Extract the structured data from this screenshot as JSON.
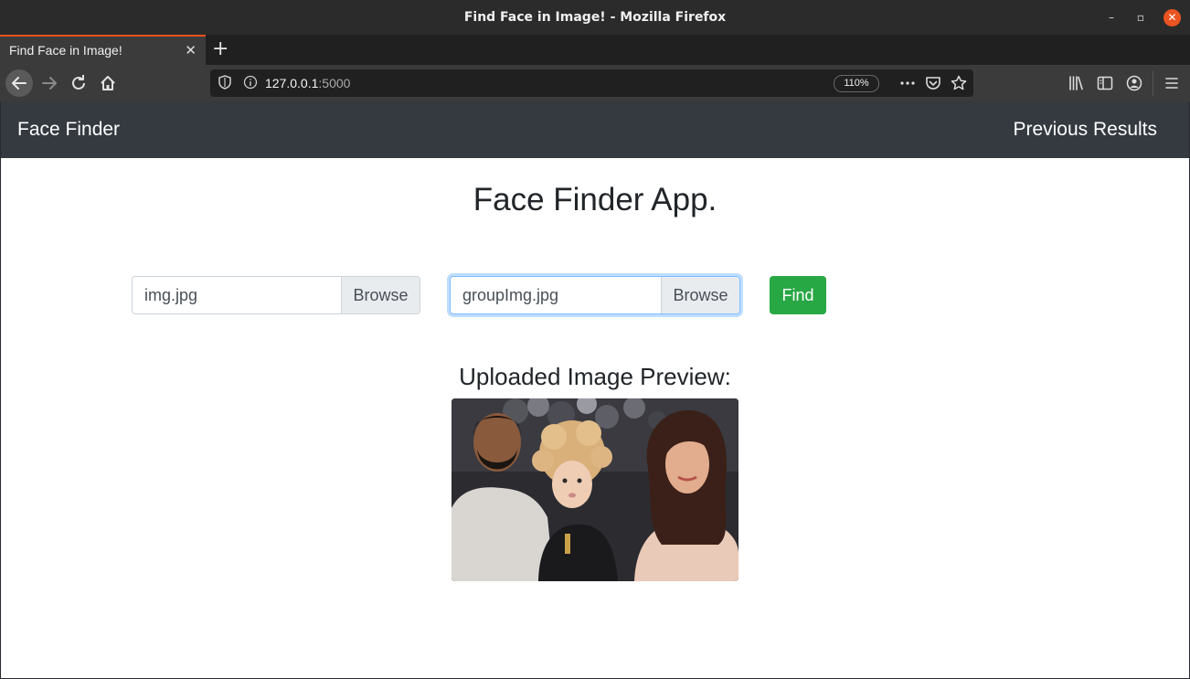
{
  "window": {
    "title": "Find Face in Image! - Mozilla Firefox",
    "minimize_glyph": "–",
    "maximize_glyph": "▫",
    "close_glyph": "✕"
  },
  "tabs": [
    {
      "label": "Find Face in Image!",
      "close_glyph": "✕"
    }
  ],
  "toolbar": {
    "new_tab_glyph": "+",
    "back_icon": "arrow-left-icon",
    "forward_icon": "arrow-right-icon",
    "reload_icon": "reload-icon",
    "home_icon": "home-icon",
    "url_host": "127.0.0.1",
    "url_port": ":5000",
    "zoom": "110%"
  },
  "app": {
    "brand": "Face Finder",
    "nav_link": "Previous Results",
    "heading": "Face Finder App.",
    "file1": {
      "name": "img.jpg",
      "browse": "Browse"
    },
    "file2": {
      "name": "groupImg.jpg",
      "browse": "Browse"
    },
    "find_label": "Find",
    "preview_title": "Uploaded Image Preview:"
  },
  "colors": {
    "navbar": "#343a40",
    "success": "#28a745",
    "focus_border": "#80bdff",
    "firefox_accent": "#e95420"
  }
}
